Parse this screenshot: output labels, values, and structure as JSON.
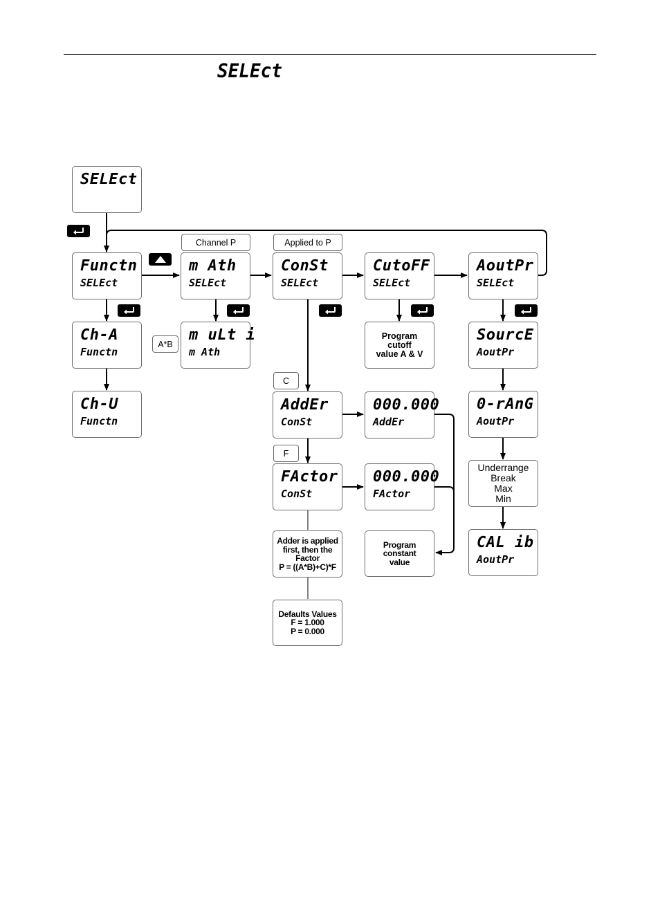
{
  "page": {
    "heading": "SELEct"
  },
  "keys": {
    "enter_icon": "enter-key-icon",
    "up_icon": "up-arrow-key-icon"
  },
  "boxes": {
    "select_root": {
      "top": "SELEct",
      "bottom": ""
    },
    "functn": {
      "top": "Functn",
      "bottom": "SELEct"
    },
    "math": {
      "top": "n̅̅ Ath",
      "top_display": "m Ath",
      "bottom": "SELEct"
    },
    "const": {
      "top": "ConSt",
      "bottom": "SELEct"
    },
    "cutoff": {
      "top": "CutoFF",
      "bottom": "SELEct"
    },
    "aoutpr": {
      "top": "AoutPr",
      "bottom": "SELEct"
    },
    "ch_a": {
      "top": "Ch-A",
      "bottom": "Functn"
    },
    "ch_v": {
      "top": "Ch-U",
      "bottom": "Functn"
    },
    "multi": {
      "top": "m uLt i",
      "bottom": "m Ath"
    },
    "adder": {
      "top": "AddEr",
      "bottom": "ConSt"
    },
    "adder_value": {
      "top": "000.000",
      "bottom": "AddEr"
    },
    "factor": {
      "top": "FActor",
      "bottom": "ConSt"
    },
    "factor_value": {
      "top": "000.000",
      "bottom": "FActor"
    },
    "source": {
      "top": "SourcE",
      "bottom": "AoutPr"
    },
    "o_range": {
      "top": "0-rAnG",
      "bottom": "AoutPr"
    },
    "calib": {
      "top": "CAL ib",
      "bottom": "AoutPr"
    }
  },
  "notes": {
    "cutoff_note": [
      "Program",
      "cutoff",
      "value A & V"
    ],
    "const_note": [
      "Program",
      "constant",
      "value"
    ],
    "adder_first_note": [
      "Adder is applied",
      "first, then the",
      "Factor",
      "P = ((A*B)+C)*F"
    ],
    "defaults_note": [
      "Defaults Values",
      "F = 1.000",
      "P = 0.000"
    ],
    "orange_options": [
      "Underrange",
      "Break",
      "Max",
      "Min"
    ]
  },
  "tags": {
    "channel_p": "Channel P",
    "applied_to_p": "Applied to P",
    "a_times_b": "A*B",
    "c": "C",
    "f": "F"
  }
}
